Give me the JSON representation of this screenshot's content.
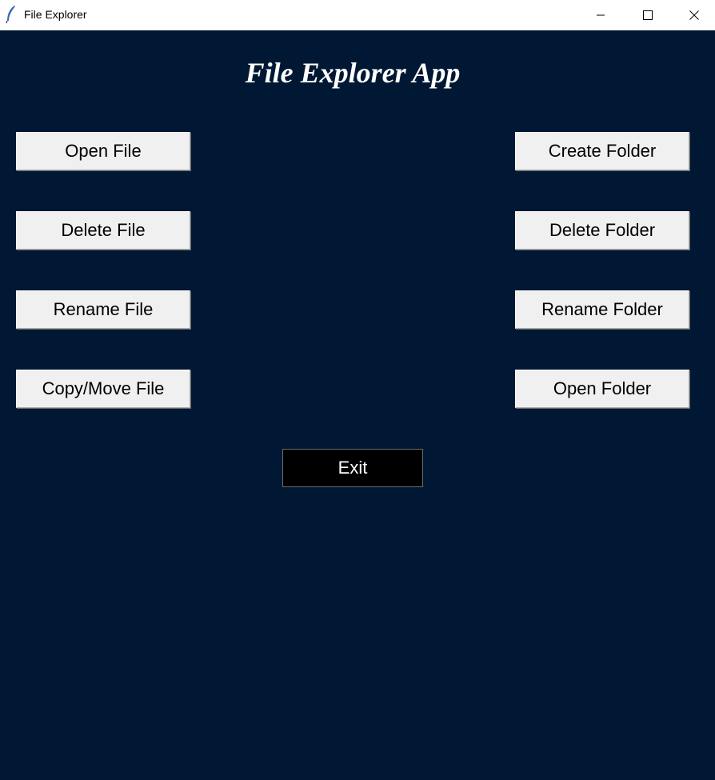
{
  "window": {
    "title": "File Explorer",
    "icon": "feather-icon",
    "controls": {
      "minimize": "minimize-icon",
      "maximize": "maximize-icon",
      "close": "close-icon"
    }
  },
  "main": {
    "heading": "File Explorer App",
    "file_buttons": [
      {
        "label": "Open File"
      },
      {
        "label": "Delete File"
      },
      {
        "label": "Rename File"
      },
      {
        "label": "Copy/Move File"
      }
    ],
    "folder_buttons": [
      {
        "label": "Create Folder"
      },
      {
        "label": "Delete Folder"
      },
      {
        "label": "Rename Folder"
      },
      {
        "label": "Open Folder"
      }
    ],
    "exit_label": "Exit"
  },
  "colors": {
    "background": "#001833",
    "button_face": "#f0f0f0",
    "exit_button": "#000000",
    "heading_text": "#ffffff"
  }
}
